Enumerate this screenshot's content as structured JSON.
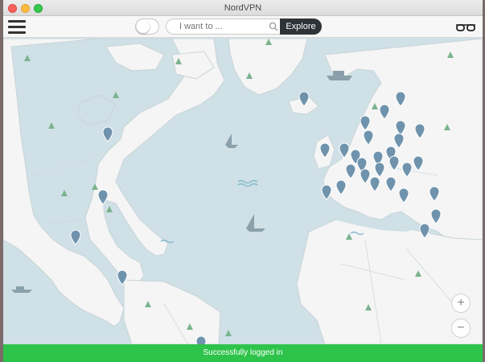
{
  "window": {
    "title": "NordVPN"
  },
  "toolbar": {
    "menu_icon": "hamburger-menu-icon",
    "search_placeholder": "I want to ...",
    "explore_label": "Explore",
    "right_icon": "glasses-icon"
  },
  "map": {
    "colors": {
      "ocean": "#cfe0e6",
      "land": "#f5f5f5",
      "border": "#c9d4d8",
      "pin": "#6f93ad",
      "tree": "#7bb38f"
    },
    "zoom_in_label": "+",
    "zoom_out_label": "−"
  },
  "status": {
    "message": "Successfully logged in",
    "color": "#2ec34a"
  }
}
